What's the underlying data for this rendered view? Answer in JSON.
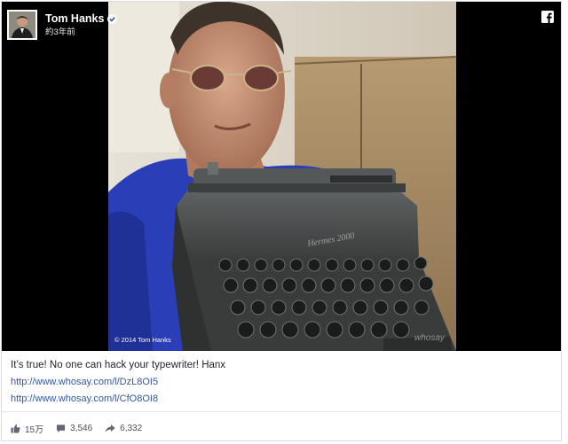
{
  "post": {
    "author": "Tom Hanks",
    "time": "約3年前",
    "caption": "It’s true! No one can hack your typewriter! Hanx",
    "links": [
      "http://www.whosay.com/l/DzL8OI5",
      "http://www.whosay.com/l/CfO8OI8"
    ],
    "photo_copyright": "© 2014 Tom Hanks",
    "photo_watermark": "whosay",
    "typewriter_brand": "Hermes 2000"
  },
  "stats": {
    "likes": "15万",
    "comments": "3,546",
    "shares": "6,332"
  },
  "icons": {
    "verified": "verified-badge-icon",
    "facebook": "facebook-icon",
    "like": "thumbs-up-icon",
    "comment": "comment-icon",
    "share": "share-arrow-icon"
  },
  "colors": {
    "link": "#365899",
    "text": "#1d2129",
    "shirt": "#2a3fb7",
    "typewriter": "#4a4d4d"
  }
}
